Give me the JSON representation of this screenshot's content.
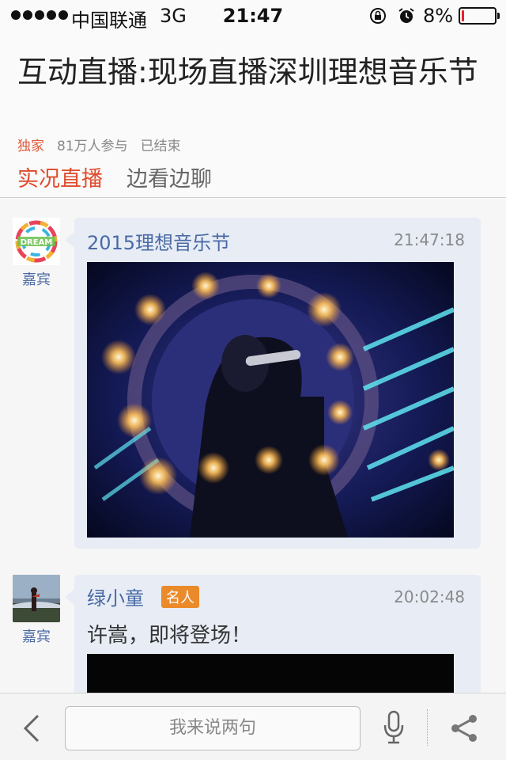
{
  "status_bar": {
    "carrier": "中国联通",
    "network": "3G",
    "time": "21:47",
    "battery_percent": "8%",
    "battery_level": 0.08,
    "icons": [
      "signal-dots",
      "rotation-lock-icon",
      "alarm-icon",
      "battery-icon"
    ]
  },
  "header": {
    "title": "互动直播:现场直播深圳理想音乐节",
    "tag": "独家",
    "participants": "81万人参与",
    "status": "已结束"
  },
  "tabs": [
    {
      "label": "实况直播",
      "active": true
    },
    {
      "label": "边看边聊",
      "active": false
    }
  ],
  "posts": [
    {
      "avatar_label": "嘉宾",
      "avatar_text": "DREAM",
      "author": "2015理想音乐节",
      "time": "21:47:18",
      "media": "concert-stage-photo"
    },
    {
      "avatar_label": "嘉宾",
      "author": "绿小童",
      "badge": "名人",
      "time": "20:02:48",
      "text": "许嵩，即将登场！"
    }
  ],
  "bottom_bar": {
    "input_placeholder": "我来说两句",
    "icons": [
      "back-icon",
      "microphone-icon",
      "share-icon"
    ]
  },
  "colors": {
    "accent": "#e04a2c",
    "link": "#4a6aa5",
    "badge": "#ea8a2a",
    "bubble": "#e7ecf5"
  }
}
